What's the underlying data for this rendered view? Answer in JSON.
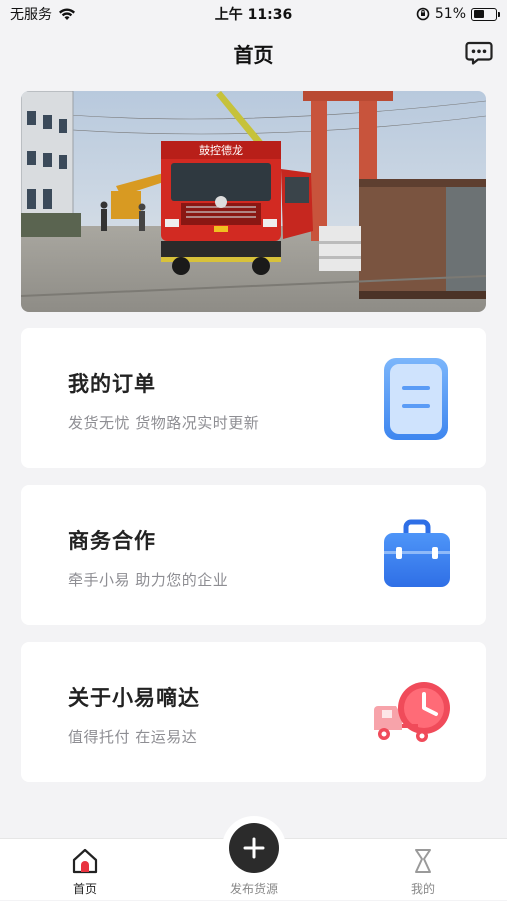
{
  "status_bar": {
    "carrier": "无服务",
    "time": "上午 11:36",
    "battery_percent": "51%",
    "battery_level": 0.51
  },
  "nav": {
    "title": "首页",
    "message_icon": "chat-bubble-icon"
  },
  "banner": {
    "truck_sign": "鼓控德龙"
  },
  "cards": [
    {
      "title": "我的订单",
      "subtitle": "发货无忧 货物路况实时更新",
      "icon": "order-document-icon",
      "icon_color": "#5b9cf6"
    },
    {
      "title": "商务合作",
      "subtitle": "牵手小易 助力您的企业",
      "icon": "briefcase-icon",
      "icon_color": "#3d7df2"
    },
    {
      "title": "关于小易嘀达",
      "subtitle": "值得托付 在运易达",
      "icon": "delivery-truck-clock-icon",
      "icon_color": "#f04b5a"
    }
  ],
  "tabs": {
    "home": "首页",
    "publish": "发布货源",
    "mine": "我的"
  },
  "colors": {
    "accent_red": "#e8333f",
    "dark": "#2b2b2b"
  }
}
